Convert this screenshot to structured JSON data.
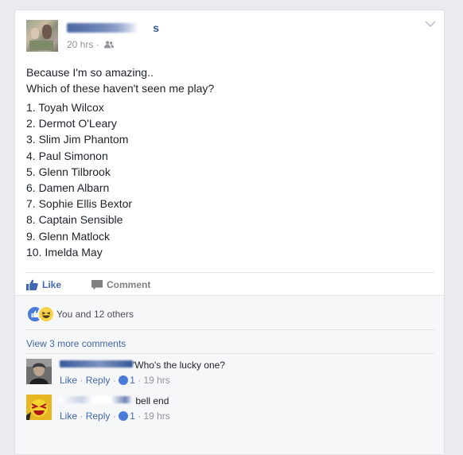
{
  "post": {
    "author_suffix": "s",
    "time": "20 hrs",
    "text_line1": "Because I'm so amazing..",
    "text_line2": "Which of these haven't seen me play?",
    "list": [
      "1. Toyah Wilcox",
      "2. Dermot O'Leary",
      "3. Slim Jim Phantom",
      "4. Paul Simonon",
      "5. Glenn Tilbrook",
      "6. Damen Albarn",
      "7. Sophie Ellis Bextor",
      "8. Captain Sensible",
      "9. Glenn Matlock",
      "10. Imelda May"
    ]
  },
  "actions": {
    "like_label": "Like",
    "comment_label": "Comment"
  },
  "reactions": {
    "summary": "You and 12 others"
  },
  "comments_section": {
    "view_more": "View 3 more comments",
    "comments": [
      {
        "text": "'Who's the lucky one?",
        "like": "Like",
        "sep1": "·",
        "reply": "Reply",
        "sep2": "·",
        "likes": "1",
        "sep3": "·",
        "time": "19 hrs"
      },
      {
        "text": "bell end",
        "like": "Like",
        "sep1": "·",
        "reply": "Reply",
        "sep2": "·",
        "likes": "1",
        "sep3": "·",
        "time": "19 hrs"
      }
    ]
  },
  "colors": {
    "link": "#4267b2",
    "name": "#365899",
    "meta": "#90949c",
    "ufi_bg": "#f6f7f9"
  },
  "icons": [
    "friends-icon",
    "chevron-down-icon",
    "like-thumb-icon",
    "comment-bubble-icon",
    "like-reaction-icon",
    "haha-reaction-icon",
    "mini-like-icon"
  ]
}
